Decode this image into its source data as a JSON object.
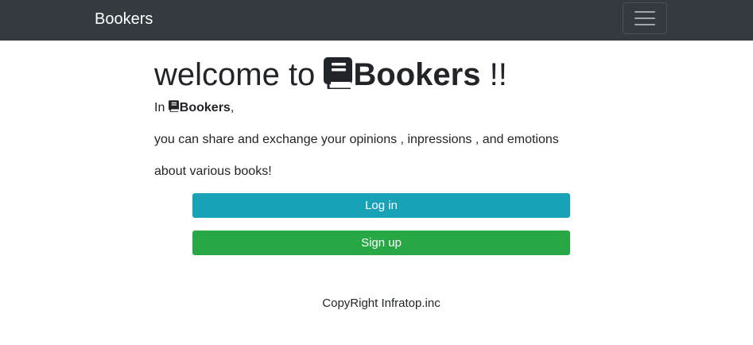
{
  "navbar": {
    "brand": "Bookers",
    "toggler_icon": "hamburger-menu-icon"
  },
  "hero": {
    "title_prefix": "welcome to ",
    "title_app": "Bookers",
    "title_suffix": " !!",
    "book_icon": "book-icon"
  },
  "intro": {
    "line1_prefix": "In ",
    "line1_app": "Bookers",
    "line1_suffix": ",",
    "line2": "you can share and exchange your opinions , inpressions , and emotions",
    "line3": "about various books!"
  },
  "actions": {
    "login_label": "Log in",
    "signup_label": "Sign up"
  },
  "footer": {
    "copyright": "CopyRight Infratop.inc"
  },
  "colors": {
    "navbar_bg": "#343a40",
    "login_bg": "#17a2b8",
    "signup_bg": "#28a745"
  }
}
